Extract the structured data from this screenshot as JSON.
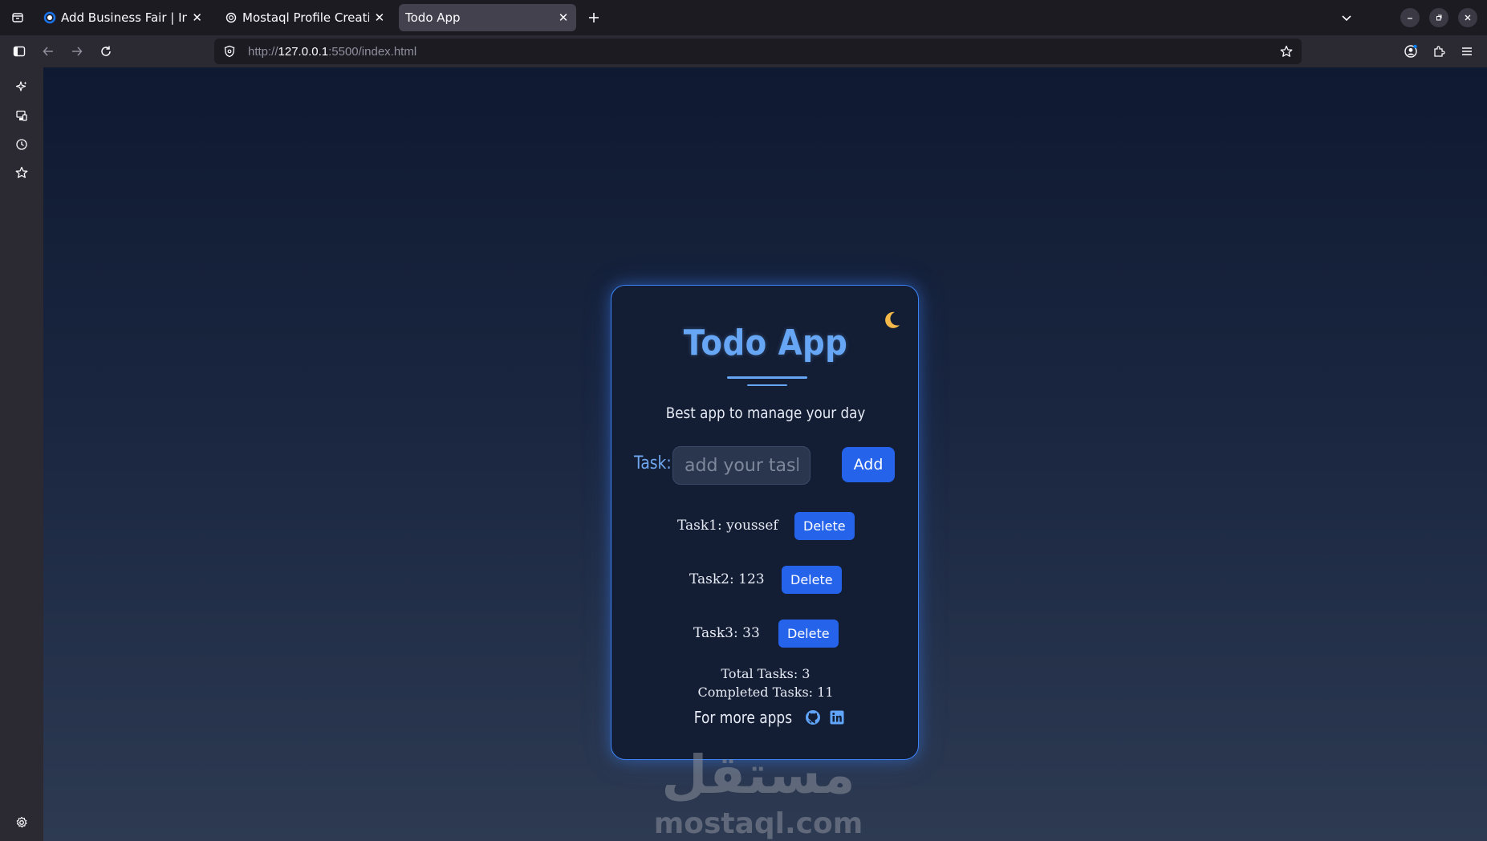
{
  "browser": {
    "tabs": [
      {
        "title": "Add Business Fair | Indepe",
        "active": false,
        "favicon": "loading-ring-icon"
      },
      {
        "title": "Mostaql Profile Creation",
        "active": false,
        "favicon": "openai-logo-icon"
      },
      {
        "title": "Todo App",
        "active": true,
        "favicon": ""
      }
    ],
    "url": {
      "scheme": "http://",
      "host": "127.0.0.1",
      "rest": ":5500/index.html"
    }
  },
  "app": {
    "title": "Todo App",
    "tagline": "Best app to manage your day",
    "task_label": "Task:",
    "input_placeholder": "add your task",
    "input_value": "",
    "add_label": "Add",
    "tasks": [
      {
        "text": "Task1: youssef",
        "delete_label": "Delete"
      },
      {
        "text": "Task2: 123",
        "delete_label": "Delete"
      },
      {
        "text": "Task3: 33",
        "delete_label": "Delete"
      }
    ],
    "total_tasks": "Total Tasks: 3",
    "completed_tasks": "Completed Tasks: 11",
    "footer_text": "For more apps",
    "social": [
      "github-icon",
      "linkedin-icon"
    ]
  },
  "watermark": {
    "arabic": "مستقل",
    "latin": "mostaql.com"
  },
  "colors": {
    "accent": "#2563eb",
    "title": "#66a6f5",
    "card_border": "#3b82f6",
    "moon": "#f5b94a"
  }
}
